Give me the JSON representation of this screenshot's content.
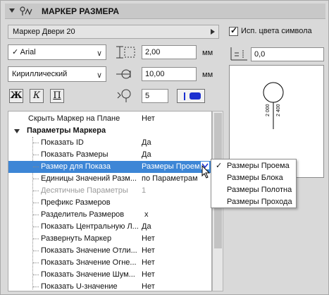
{
  "header": {
    "title": "МАРКЕР РАЗМЕРА"
  },
  "marker": {
    "name": "Маркер Двери 20"
  },
  "symbol_color": {
    "label": "Исп. цвета символа",
    "checked": true
  },
  "font": {
    "family": "Arial",
    "script": "Кириллический"
  },
  "size": {
    "height": "2,00",
    "width": "10,00",
    "pen": "5",
    "unit": "мм",
    "rotation": "0,0"
  },
  "styles": {
    "bold": "Ж",
    "italic": "К",
    "underline": "П"
  },
  "tree": {
    "rows": [
      {
        "label": "Скрыть Маркер на Плане",
        "value": "Нет"
      },
      {
        "label": "Параметры Маркера",
        "value": ""
      },
      {
        "label": "Показать ID",
        "value": "Да"
      },
      {
        "label": "Показать Размеры",
        "value": "Да"
      },
      {
        "label": "Размер для Показа",
        "value": "Размеры Проема"
      },
      {
        "label": "Единицы Значений Разм...",
        "value": "по Параметрам"
      },
      {
        "label": "Десятичные Параметры",
        "value": "1"
      },
      {
        "label": "Префикс Размеров",
        "value": ""
      },
      {
        "label": "Разделитель Размеров",
        "value": "x"
      },
      {
        "label": "Показать Центральную Л...",
        "value": "Да"
      },
      {
        "label": "Развернуть Маркер",
        "value": "Нет"
      },
      {
        "label": "Показать Значение Отли...",
        "value": "Нет"
      },
      {
        "label": "Показать Значение Огне...",
        "value": "Нет"
      },
      {
        "label": "Показать Значение Шум...",
        "value": "Нет"
      },
      {
        "label": "Показать U-значение",
        "value": "Нет"
      }
    ]
  },
  "dropdown_menu": {
    "items": [
      {
        "label": "Размеры Проема",
        "checked": true
      },
      {
        "label": "Размеры Блока",
        "checked": false
      },
      {
        "label": "Размеры Полотна",
        "checked": false
      },
      {
        "label": "Размеры Прохода",
        "checked": false
      }
    ]
  },
  "preview": {
    "text1": "2 000",
    "text2": "2 400"
  },
  "colors": {
    "selection": "#3d86d6",
    "pen": "#1a2fd0"
  }
}
